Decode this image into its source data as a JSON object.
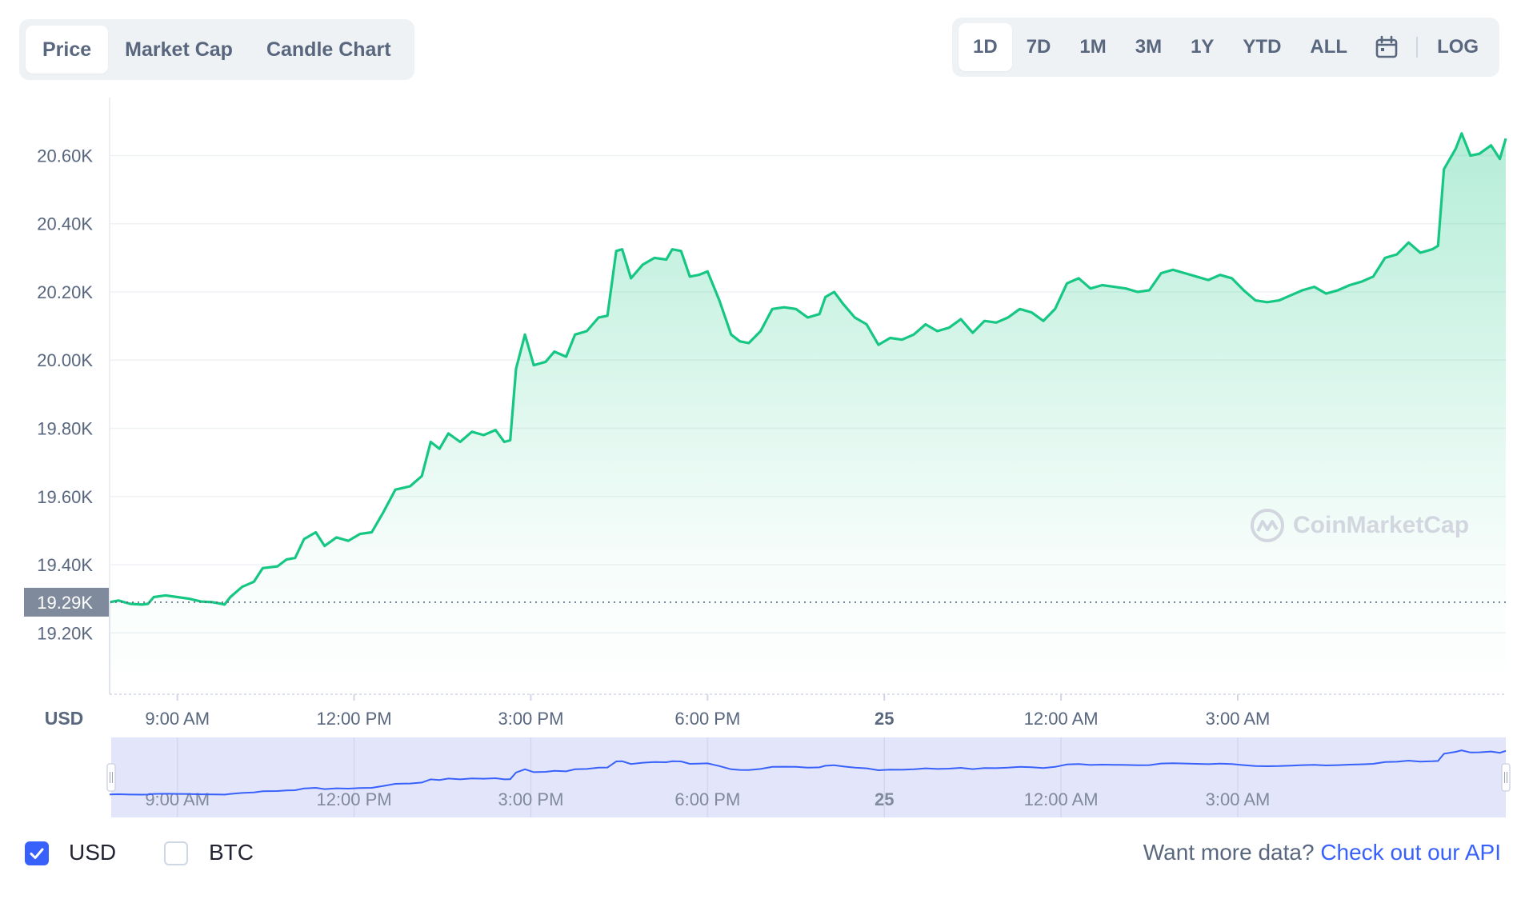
{
  "tabs": [
    {
      "label": "Price",
      "active": true
    },
    {
      "label": "Market Cap",
      "active": false
    },
    {
      "label": "Candle Chart",
      "active": false
    }
  ],
  "ranges": [
    {
      "label": "1D",
      "active": true
    },
    {
      "label": "7D",
      "active": false
    },
    {
      "label": "1M",
      "active": false
    },
    {
      "label": "3M",
      "active": false
    },
    {
      "label": "1Y",
      "active": false
    },
    {
      "label": "YTD",
      "active": false
    },
    {
      "label": "ALL",
      "active": false
    }
  ],
  "log_label": "LOG",
  "calendar_icon": "calendar-icon",
  "watermark": "CoinMarketCap",
  "footer": {
    "usd_label": "USD",
    "usd_checked": true,
    "btc_label": "BTC",
    "btc_checked": false,
    "api_prompt": "Want more data?",
    "api_link": "Check out our API"
  },
  "colors": {
    "line": "#16c784",
    "line_below_open": "#ea3943",
    "accent": "#3861fb",
    "navigator_fill": "#e3e6fa",
    "navigator_line": "#3861fb"
  },
  "chart_data": {
    "type": "area",
    "currency_label": "USD",
    "open_price_label": "19.29K",
    "open_price": 19290,
    "y_ticks": [
      {
        "value": 20600,
        "label": "20.60K"
      },
      {
        "value": 20400,
        "label": "20.40K"
      },
      {
        "value": 20200,
        "label": "20.20K"
      },
      {
        "value": 20000,
        "label": "20.00K"
      },
      {
        "value": 19800,
        "label": "19.80K"
      },
      {
        "value": 19600,
        "label": "19.60K"
      },
      {
        "value": 19400,
        "label": "19.40K"
      },
      {
        "value": 19200,
        "label": "19.20K"
      }
    ],
    "ylim": [
      19020,
      20770
    ],
    "x_range_hours": [
      7.85,
      31.55
    ],
    "x_ticks": [
      {
        "hour": 9,
        "label": "9:00 AM",
        "bold": false
      },
      {
        "hour": 12,
        "label": "12:00 PM",
        "bold": false
      },
      {
        "hour": 15,
        "label": "3:00 PM",
        "bold": false
      },
      {
        "hour": 18,
        "label": "6:00 PM",
        "bold": false
      },
      {
        "hour": 21,
        "label": "25",
        "bold": true
      },
      {
        "hour": 24,
        "label": "12:00 AM",
        "bold": false
      },
      {
        "hour": 27,
        "label": "3:00 AM",
        "bold": false
      }
    ],
    "points": [
      [
        7.85,
        19290
      ],
      [
        8.0,
        19295
      ],
      [
        8.2,
        19285
      ],
      [
        8.4,
        19283
      ],
      [
        8.5,
        19285
      ],
      [
        8.6,
        19305
      ],
      [
        8.8,
        19310
      ],
      [
        9.0,
        19305
      ],
      [
        9.2,
        19300
      ],
      [
        9.4,
        19292
      ],
      [
        9.6,
        19290
      ],
      [
        9.75,
        19285
      ],
      [
        9.8,
        19283
      ],
      [
        9.9,
        19305
      ],
      [
        10.1,
        19335
      ],
      [
        10.3,
        19350
      ],
      [
        10.45,
        19390
      ],
      [
        10.7,
        19395
      ],
      [
        10.85,
        19415
      ],
      [
        11.0,
        19420
      ],
      [
        11.15,
        19475
      ],
      [
        11.35,
        19495
      ],
      [
        11.5,
        19455
      ],
      [
        11.7,
        19480
      ],
      [
        11.9,
        19470
      ],
      [
        12.1,
        19490
      ],
      [
        12.3,
        19495
      ],
      [
        12.5,
        19555
      ],
      [
        12.7,
        19620
      ],
      [
        12.95,
        19630
      ],
      [
        13.15,
        19660
      ],
      [
        13.3,
        19760
      ],
      [
        13.45,
        19740
      ],
      [
        13.6,
        19785
      ],
      [
        13.8,
        19760
      ],
      [
        14.0,
        19790
      ],
      [
        14.2,
        19780
      ],
      [
        14.4,
        19795
      ],
      [
        14.55,
        19760
      ],
      [
        14.65,
        19765
      ],
      [
        14.75,
        19975
      ],
      [
        14.9,
        20075
      ],
      [
        15.05,
        19985
      ],
      [
        15.25,
        19995
      ],
      [
        15.4,
        20025
      ],
      [
        15.6,
        20010
      ],
      [
        15.75,
        20075
      ],
      [
        15.95,
        20085
      ],
      [
        16.15,
        20125
      ],
      [
        16.3,
        20130
      ],
      [
        16.45,
        20320
      ],
      [
        16.55,
        20325
      ],
      [
        16.7,
        20240
      ],
      [
        16.9,
        20280
      ],
      [
        17.1,
        20300
      ],
      [
        17.3,
        20295
      ],
      [
        17.4,
        20325
      ],
      [
        17.55,
        20320
      ],
      [
        17.7,
        20245
      ],
      [
        17.85,
        20250
      ],
      [
        18.0,
        20260
      ],
      [
        18.2,
        20175
      ],
      [
        18.4,
        20075
      ],
      [
        18.55,
        20055
      ],
      [
        18.7,
        20050
      ],
      [
        18.9,
        20085
      ],
      [
        19.1,
        20150
      ],
      [
        19.3,
        20155
      ],
      [
        19.5,
        20150
      ],
      [
        19.7,
        20125
      ],
      [
        19.9,
        20135
      ],
      [
        20.0,
        20185
      ],
      [
        20.15,
        20200
      ],
      [
        20.3,
        20165
      ],
      [
        20.5,
        20125
      ],
      [
        20.7,
        20105
      ],
      [
        20.9,
        20045
      ],
      [
        21.1,
        20065
      ],
      [
        21.3,
        20060
      ],
      [
        21.5,
        20075
      ],
      [
        21.7,
        20105
      ],
      [
        21.9,
        20085
      ],
      [
        22.1,
        20095
      ],
      [
        22.3,
        20120
      ],
      [
        22.5,
        20080
      ],
      [
        22.7,
        20115
      ],
      [
        22.9,
        20110
      ],
      [
        23.1,
        20125
      ],
      [
        23.3,
        20150
      ],
      [
        23.5,
        20140
      ],
      [
        23.7,
        20115
      ],
      [
        23.9,
        20150
      ],
      [
        24.1,
        20225
      ],
      [
        24.3,
        20240
      ],
      [
        24.5,
        20210
      ],
      [
        24.7,
        20220
      ],
      [
        24.9,
        20215
      ],
      [
        25.1,
        20210
      ],
      [
        25.3,
        20200
      ],
      [
        25.5,
        20205
      ],
      [
        25.7,
        20255
      ],
      [
        25.9,
        20265
      ],
      [
        26.1,
        20255
      ],
      [
        26.3,
        20245
      ],
      [
        26.5,
        20235
      ],
      [
        26.7,
        20250
      ],
      [
        26.9,
        20240
      ],
      [
        27.1,
        20205
      ],
      [
        27.3,
        20175
      ],
      [
        27.5,
        20170
      ],
      [
        27.7,
        20175
      ],
      [
        27.9,
        20190
      ],
      [
        28.1,
        20205
      ],
      [
        28.3,
        20215
      ],
      [
        28.5,
        20195
      ],
      [
        28.7,
        20205
      ],
      [
        28.9,
        20220
      ],
      [
        29.1,
        20230
      ],
      [
        29.3,
        20245
      ],
      [
        29.5,
        20300
      ],
      [
        29.7,
        20310
      ],
      [
        29.9,
        20345
      ],
      [
        30.1,
        20315
      ],
      [
        30.3,
        20325
      ],
      [
        30.4,
        20335
      ],
      [
        30.5,
        20560
      ],
      [
        30.7,
        20620
      ],
      [
        30.8,
        20665
      ],
      [
        30.95,
        20600
      ],
      [
        31.1,
        20605
      ],
      [
        31.3,
        20630
      ],
      [
        31.45,
        20590
      ],
      [
        31.55,
        20650
      ]
    ]
  }
}
